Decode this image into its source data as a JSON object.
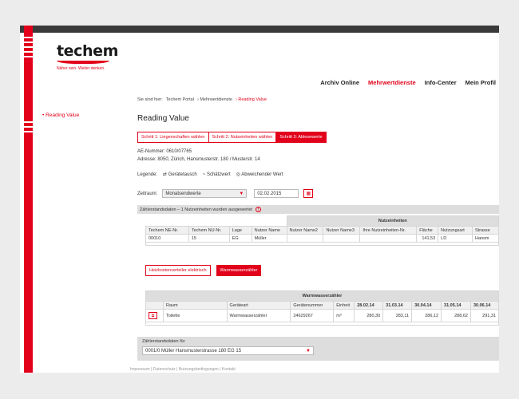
{
  "brand": {
    "name": "techem",
    "tagline": "Näher sein. Weiter denken.",
    "accent": "#e2001a"
  },
  "nav": [
    {
      "label": "Archiv Online",
      "active": false
    },
    {
      "label": "Mehrwertdienste",
      "active": true
    },
    {
      "label": "Info-Center",
      "active": false
    },
    {
      "label": "Mein Profil",
      "active": false
    }
  ],
  "breadcrumb": {
    "prefix": "Sie sind hier:",
    "items": [
      "Techem Portal",
      "› Mehrwertdienste",
      "› Reading Value"
    ]
  },
  "sidebar": {
    "item": "• Reading Value"
  },
  "page": {
    "title": "Reading Value"
  },
  "steps": [
    {
      "label": "Schritt 1: Liegenschaften wählen",
      "active": false
    },
    {
      "label": "Schritt 2: Nutzeinheiten wählen",
      "active": false
    },
    {
      "label": "Schritt 3: Ablesewerte",
      "active": true
    }
  ],
  "info": {
    "ae": "AE-Nummer: 0610/07765",
    "address": "Adresse: 8050, Zürich, Hansmusterstr. 180 / Musterstr. 14"
  },
  "legend": {
    "label": "Legende:",
    "items": [
      {
        "icon": "swap-icon",
        "glyph": "⇄",
        "text": "Gerätetausch"
      },
      {
        "icon": "estimate-icon",
        "glyph": "~",
        "text": "Schätzwert"
      },
      {
        "icon": "deviation-icon",
        "glyph": "◎",
        "text": "Abweichender Wert"
      }
    ]
  },
  "zeitraum": {
    "label": "Zeitraum:",
    "select_value": "Monatsendwerte",
    "date_value": "02.02.2015"
  },
  "panel1": {
    "title": "Zählerstandsdaten – 1 Nutzeinheiten wurden ausgewertet"
  },
  "nutz_table": {
    "group": "Nutzeinheiten",
    "headers": [
      "Techem NE-Nr.",
      "Techem NU-Nr.",
      "Lage",
      "Nutzer Name",
      "Nutzer Name2",
      "Nutzer Name3",
      "Ihre Nutzeinheiten-Nr.",
      "Fläche",
      "Nutzungsart",
      "Strasse"
    ],
    "row": [
      "00010",
      "15",
      "EG",
      "Müller",
      "",
      "",
      "",
      "141,53",
      "LD",
      "Hansm"
    ]
  },
  "device_tabs": [
    {
      "label": "Heizkostenverteiler elektrisch",
      "active": false
    },
    {
      "label": "Warmwasserzähler",
      "active": true
    }
  ],
  "ww_table": {
    "group": "Warmwasserzähler",
    "headers": [
      "",
      "Raum",
      "Geräteart",
      "Gerätenummer",
      "Einheit",
      "28.02.14",
      "31.03.14",
      "30.04.14",
      "31.05.14",
      "30.06.14"
    ],
    "row": [
      "",
      "Toilette",
      "Warmwasserzähler",
      "24629267",
      "m³",
      "280,30",
      "283,11",
      "286,12",
      "288,62",
      "291,31"
    ]
  },
  "footer": {
    "label": "Zählerstandsdaten für",
    "select_value": "0001/0 Müller Hansmusterstrasse 180 EG 15"
  },
  "underfoot": "Impressum  |  Datenschutz  |  Nutzungsbedingungen  |  Kontakt"
}
